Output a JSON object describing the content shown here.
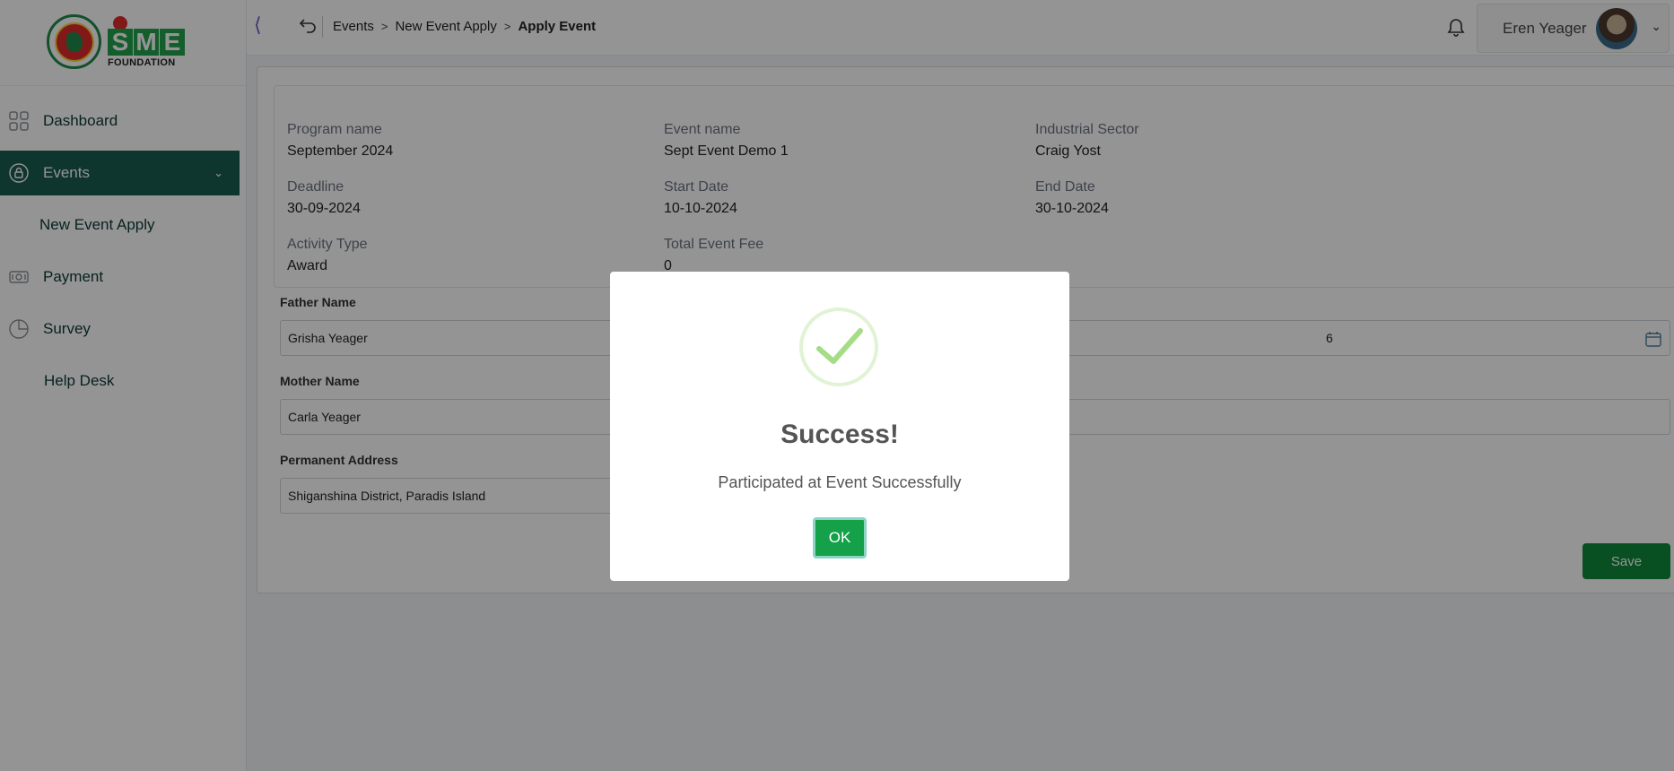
{
  "brand": {
    "logo_letters": [
      "S",
      "M",
      "E"
    ],
    "logo_subtitle": "FOUNDATION"
  },
  "sidebar": {
    "items": [
      {
        "label": "Dashboard",
        "icon": "grid-icon"
      },
      {
        "label": "Events",
        "icon": "lock-icon"
      },
      {
        "label": "New Event Apply"
      },
      {
        "label": "Payment",
        "icon": "money-icon"
      },
      {
        "label": "Survey",
        "icon": "pie-chart-icon"
      },
      {
        "label": "Help Desk"
      }
    ]
  },
  "breadcrumb": {
    "items": [
      "Events",
      "New Event Apply",
      "Apply Event"
    ]
  },
  "user": {
    "name": "Eren Yeager"
  },
  "event_info": {
    "program_name": {
      "label": "Program name",
      "value": "September 2024"
    },
    "event_name": {
      "label": "Event name",
      "value": "Sept Event Demo 1"
    },
    "industrial_sector": {
      "label": "Industrial Sector",
      "value": "Craig Yost"
    },
    "deadline": {
      "label": "Deadline",
      "value": "30-09-2024"
    },
    "start_date": {
      "label": "Start Date",
      "value": "10-10-2024"
    },
    "end_date": {
      "label": "End Date",
      "value": "30-10-2024"
    },
    "activity_type": {
      "label": "Activity Type",
      "value": "Award"
    },
    "total_event_fee": {
      "label": "Total Event Fee",
      "value": "0"
    }
  },
  "form": {
    "father_name": {
      "label": "Father Name",
      "value": "Grisha Yeager"
    },
    "mother_name": {
      "label": "Mother Name",
      "value": "Carla Yeager"
    },
    "permanent_address": {
      "label": "Permanent Address",
      "value": "Shiganshina District, Paradis Island"
    },
    "date_field_partial": "6",
    "save_label": "Save"
  },
  "modal": {
    "title": "Success!",
    "message": "Participated at Event Successfully",
    "ok_label": "OK"
  },
  "colors": {
    "sidebar_active": "#1a5c52",
    "save_button": "#0f8a3a",
    "ok_button": "#15a04a",
    "success_check": "#a5dc86"
  }
}
